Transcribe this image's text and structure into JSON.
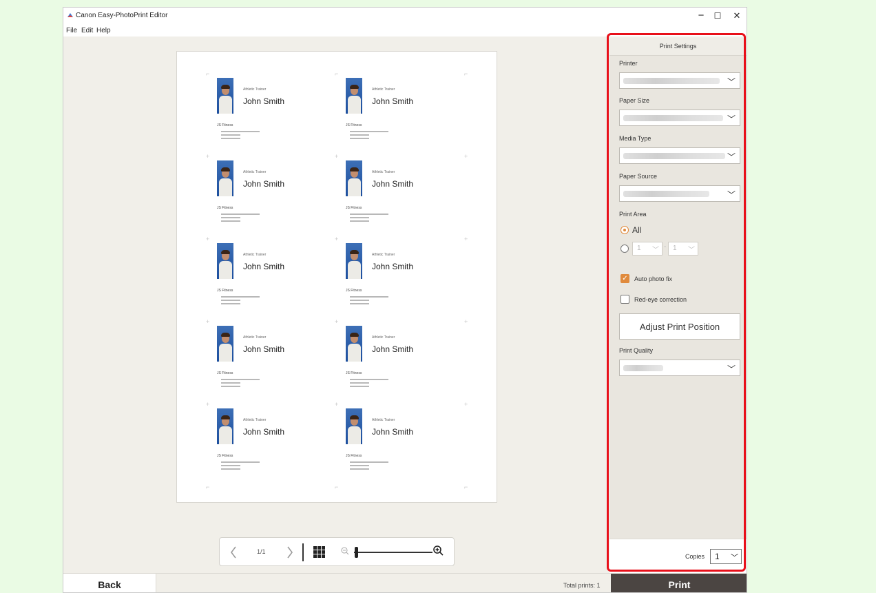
{
  "window": {
    "title": "Canon Easy-PhotoPrint Editor",
    "controls": {
      "minimize": "−",
      "maximize": "☐",
      "close": "✕"
    }
  },
  "menu": [
    "File",
    "Edit",
    "Help"
  ],
  "card": {
    "role": "Athletic Trainer",
    "name": "John Smith",
    "company": "JS Fitness"
  },
  "viewer": {
    "page_indicator": "1/1",
    "prev_icon": "chevron-left-icon",
    "next_icon": "chevron-right-icon",
    "zoom_level": 0.0
  },
  "print_settings": {
    "header": "Print Settings",
    "printer_label": "Printer",
    "paper_size_label": "Paper Size",
    "media_type_label": "Media Type",
    "paper_source_label": "Paper Source",
    "print_area_label": "Print Area",
    "print_area_all": "All",
    "range_from": "1",
    "range_to": "1",
    "range_dash": "-",
    "auto_photo_fix": "Auto photo fix",
    "auto_photo_fix_checked": true,
    "red_eye": "Red-eye correction",
    "red_eye_checked": false,
    "adjust_button": "Adjust Print Position",
    "print_quality_label": "Print Quality",
    "copies_label": "Copies",
    "copies_value": "1"
  },
  "bottom": {
    "back": "Back",
    "total_prints": "Total prints: 1",
    "print": "Print"
  },
  "colors": {
    "accent": "#e08a3c",
    "highlight": "#e8101a",
    "print_button": "#4b4542"
  }
}
